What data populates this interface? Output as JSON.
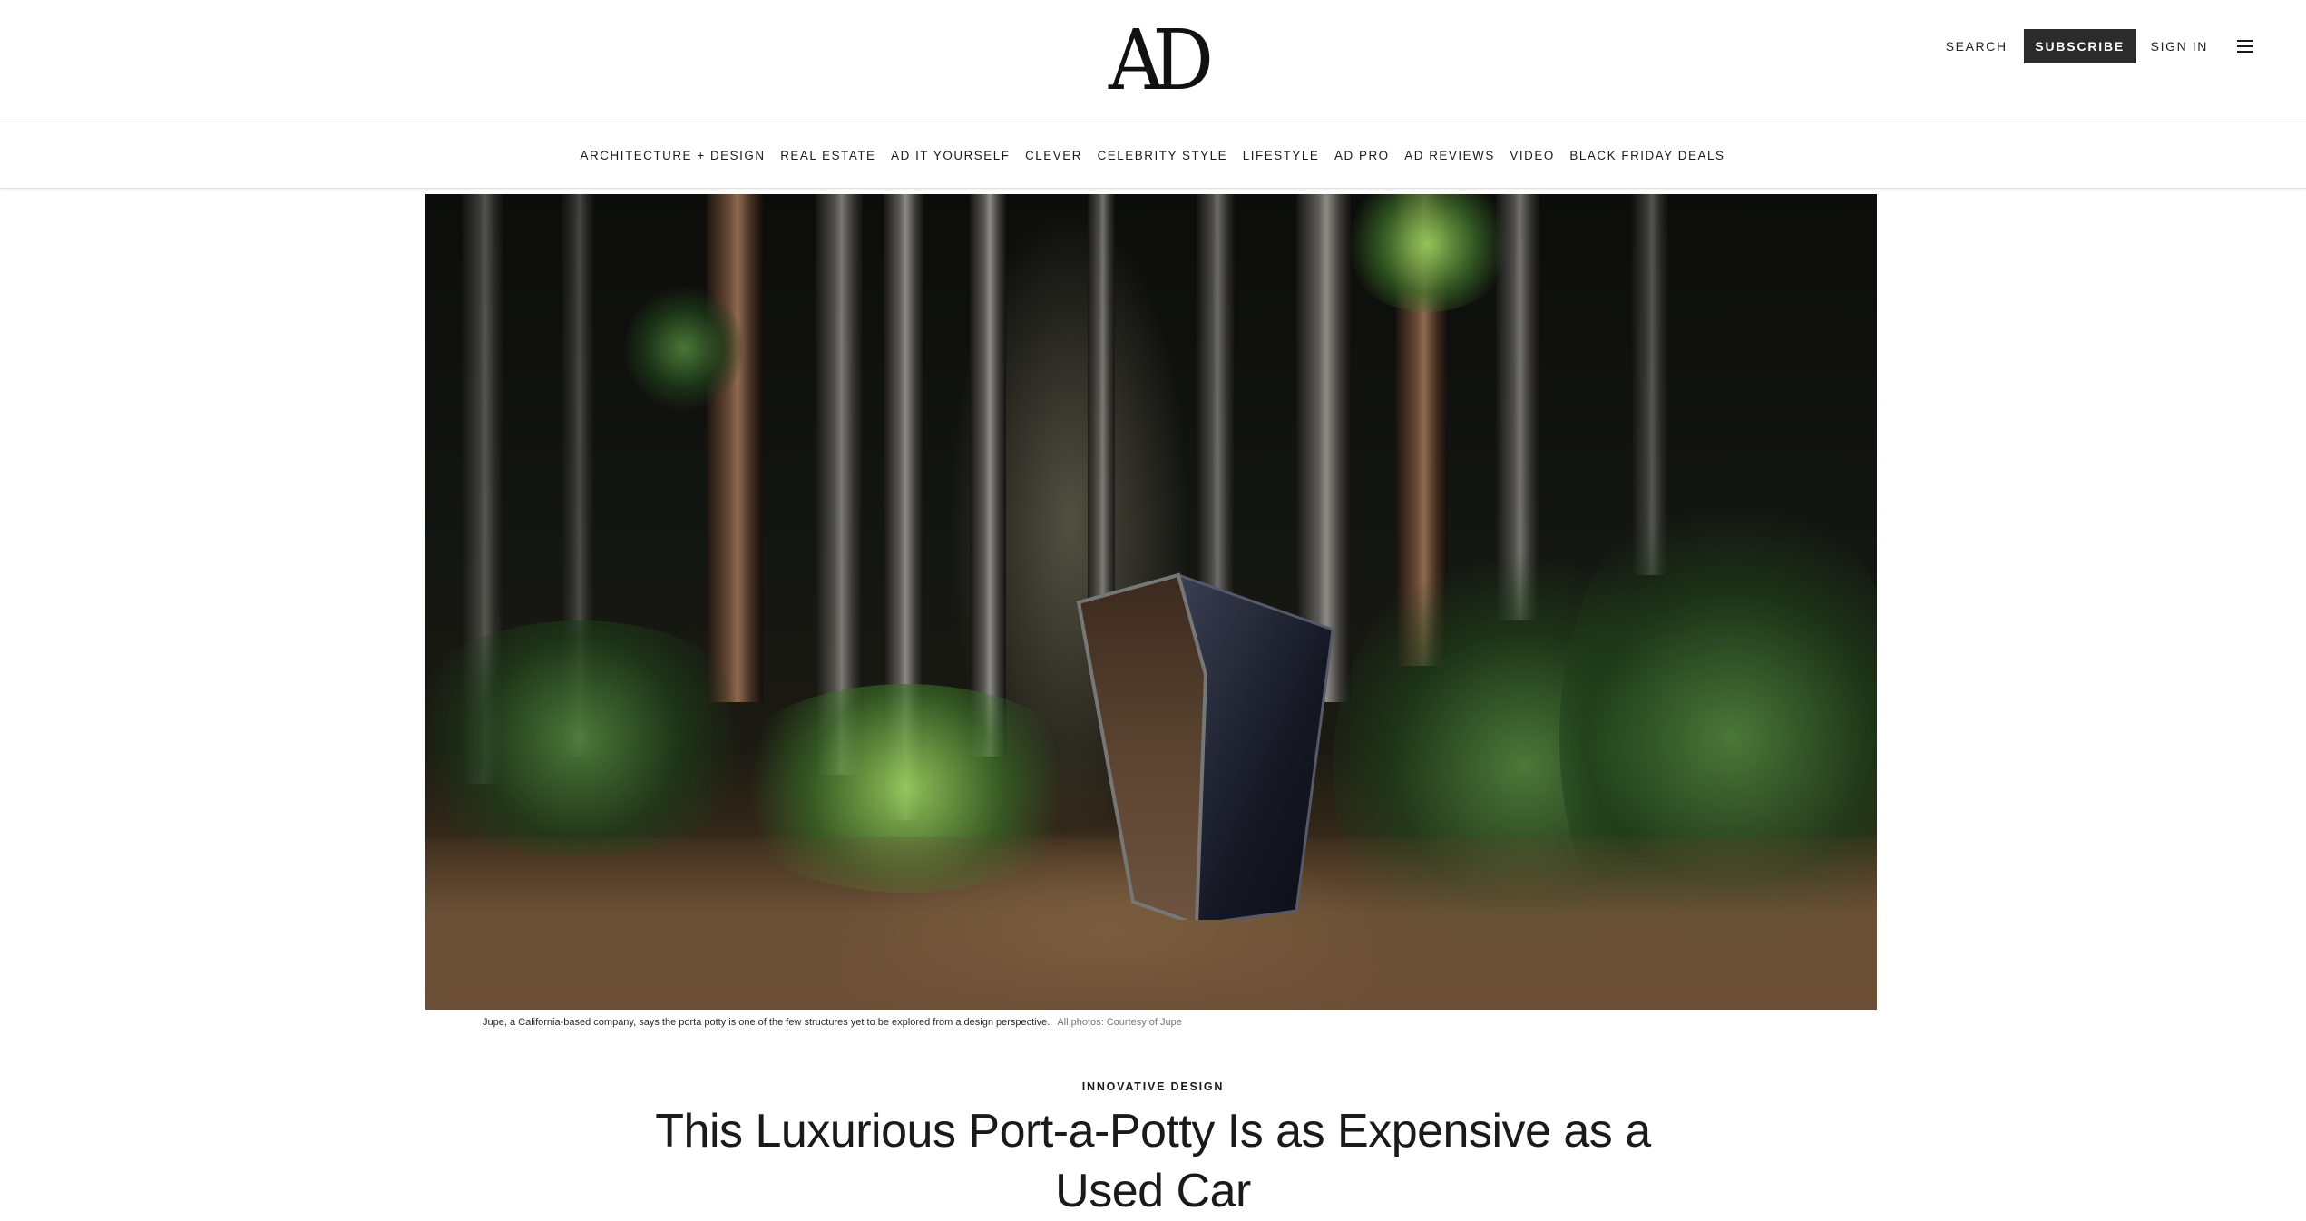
{
  "header": {
    "logo": "AD",
    "search_label": "SEARCH",
    "subscribe_label": "SUBSCRIBE",
    "signin_label": "SIGN IN",
    "menu_icon": "hamburger-menu-icon"
  },
  "nav": {
    "items": [
      "ARCHITECTURE + DESIGN",
      "REAL ESTATE",
      "AD IT YOURSELF",
      "CLEVER",
      "CELEBRITY STYLE",
      "LIFESTYLE",
      "AD PRO",
      "AD REVIEWS",
      "VIDEO",
      "BLACK FRIDAY DEALS"
    ]
  },
  "hero": {
    "caption": "Jupe, a California-based company, says the porta potty is one of the few structures yet to be explored from a design perspective.",
    "credit": "All photos: Courtesy of Jupe"
  },
  "article": {
    "rubric": "INNOVATIVE DESIGN",
    "headline": "This Luxurious Port-a-Potty Is as Expensive as a Used Car"
  },
  "colors": {
    "subscribe_bg": "#2b2b2b",
    "text": "#1a1a1a",
    "border": "#dcdcdc"
  }
}
